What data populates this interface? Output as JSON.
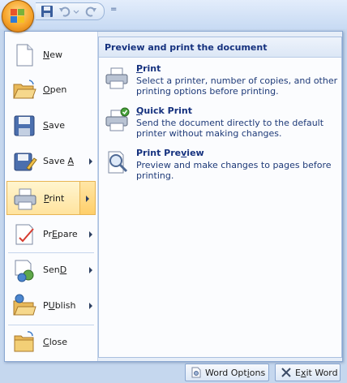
{
  "quick_access": {
    "separator": "="
  },
  "menu": {
    "items": [
      {
        "label": "New",
        "mnemonic": "N",
        "rest": "ew"
      },
      {
        "label": "Open",
        "mnemonic": "O",
        "rest": "pen"
      },
      {
        "label": "Save",
        "mnemonic": "S",
        "rest": "ave"
      },
      {
        "label": "Save As",
        "mnemonic": "A",
        "prefix": "Save ",
        "rest": ""
      },
      {
        "label": "Print",
        "mnemonic": "P",
        "rest": "rint"
      },
      {
        "label": "Prepare",
        "mnemonic": "E",
        "prefix": "Pr",
        "rest": "pare"
      },
      {
        "label": "Send",
        "mnemonic": "D",
        "prefix": "Sen",
        "rest": ""
      },
      {
        "label": "Publish",
        "mnemonic": "U",
        "prefix": "P",
        "rest": "blish"
      },
      {
        "label": "Close",
        "mnemonic": "C",
        "rest": "lose"
      }
    ]
  },
  "submenu": {
    "header": "Preview and print the document",
    "items": [
      {
        "title": "Print",
        "title_mnemonic": "P",
        "title_rest": "rint",
        "description": "Select a printer, number of copies, and other printing options before printing."
      },
      {
        "title": "Quick Print",
        "title_mnemonic": "Q",
        "title_rest": "uick Print",
        "description": "Send the document directly to the default printer without making changes."
      },
      {
        "title": "Print Preview",
        "title_prefix": "Print Pre",
        "title_mnemonic": "v",
        "title_rest": "iew",
        "description": "Preview and make changes to pages before printing."
      }
    ]
  },
  "footer": {
    "word_options": {
      "prefix": "Word Opt",
      "mnemonic": "i",
      "rest": "ons"
    },
    "exit_word": {
      "prefix": "E",
      "mnemonic": "x",
      "rest": "it Word"
    }
  },
  "colors": {
    "accent_orange": "#f6a329",
    "hover_yellow": "#ffe39e",
    "title_blue": "#15317e",
    "frame_blue": "#c5d7ee"
  }
}
